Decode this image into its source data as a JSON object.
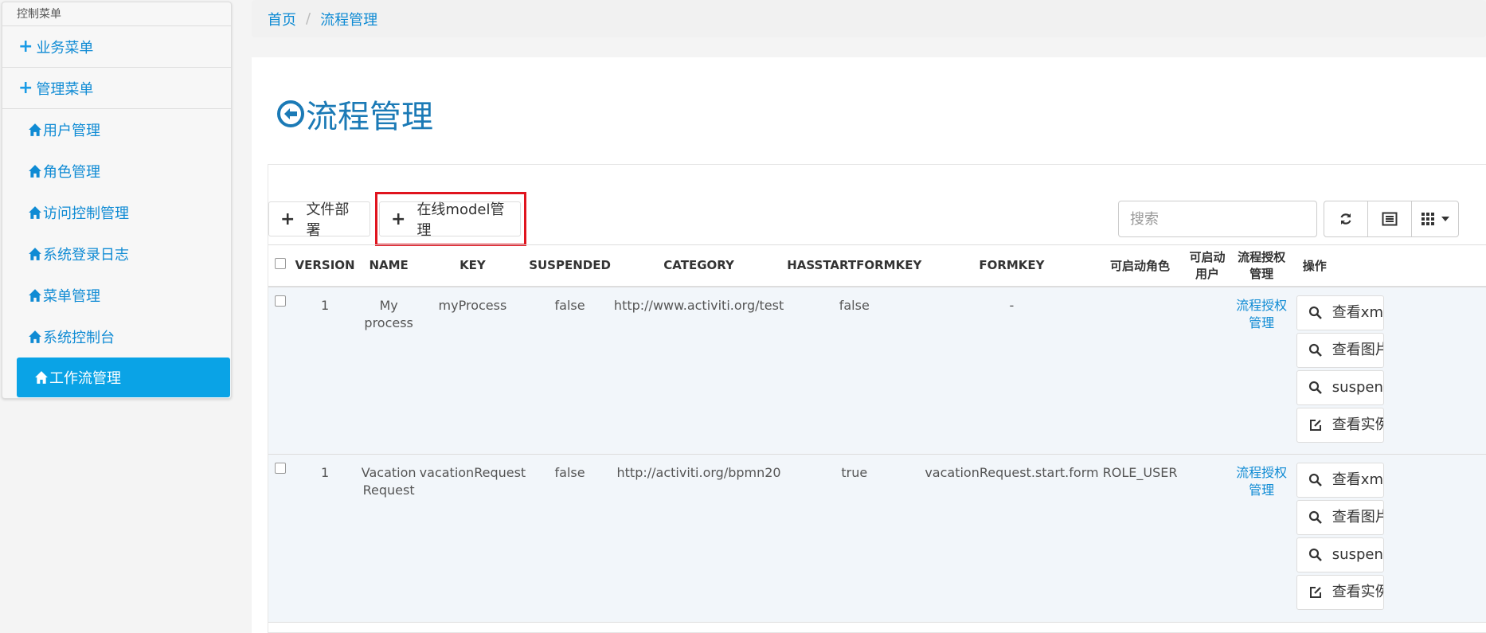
{
  "sidebar": {
    "header": "控制菜单",
    "groups": [
      {
        "label": "业务菜单"
      },
      {
        "label": "管理菜单"
      }
    ],
    "items": [
      {
        "label": "用户管理"
      },
      {
        "label": "角色管理"
      },
      {
        "label": "访问控制管理"
      },
      {
        "label": "系统登录日志"
      },
      {
        "label": "菜单管理"
      },
      {
        "label": "系统控制台"
      },
      {
        "label": "工作流管理"
      }
    ]
  },
  "breadcrumb": {
    "home": "首页",
    "separator": "/",
    "current": "流程管理"
  },
  "page": {
    "title": "流程管理"
  },
  "toolbar": {
    "deploy_label": "文件部署",
    "model_label": "在线model管理",
    "search_placeholder": "搜索"
  },
  "table": {
    "columns": [
      "VERSION",
      "NAME",
      "KEY",
      "SUSPENDED",
      "CATEGORY",
      "HASSTARTFORMKEY",
      "FORMKEY",
      "可启动角色",
      "可启动用户",
      "流程授权管理",
      "操作"
    ],
    "rows": [
      {
        "version": "1",
        "name": "My process",
        "key": "myProcess",
        "suspended": "false",
        "category": "http://www.activiti.org/test",
        "hasstartformkey": "false",
        "formkey": "-",
        "roles": "",
        "users": "",
        "auth_link": "流程授权管理",
        "ops": [
          "查看xml",
          "查看图片",
          "suspend",
          "查看实例"
        ]
      },
      {
        "version": "1",
        "name": "Vacation Request",
        "key": "vacationRequest",
        "suspended": "false",
        "category": "http://activiti.org/bpmn20",
        "hasstartformkey": "true",
        "formkey": "vacationRequest.start.form",
        "roles": "ROLE_USER",
        "users": "",
        "auth_link": "流程授权管理",
        "ops": [
          "查看xml",
          "查看图片",
          "suspend",
          "查看实例"
        ]
      }
    ]
  },
  "colors": {
    "accent": "#0f8bd4",
    "active_menu": "#0aa3e6",
    "highlight": "#e0141e"
  }
}
